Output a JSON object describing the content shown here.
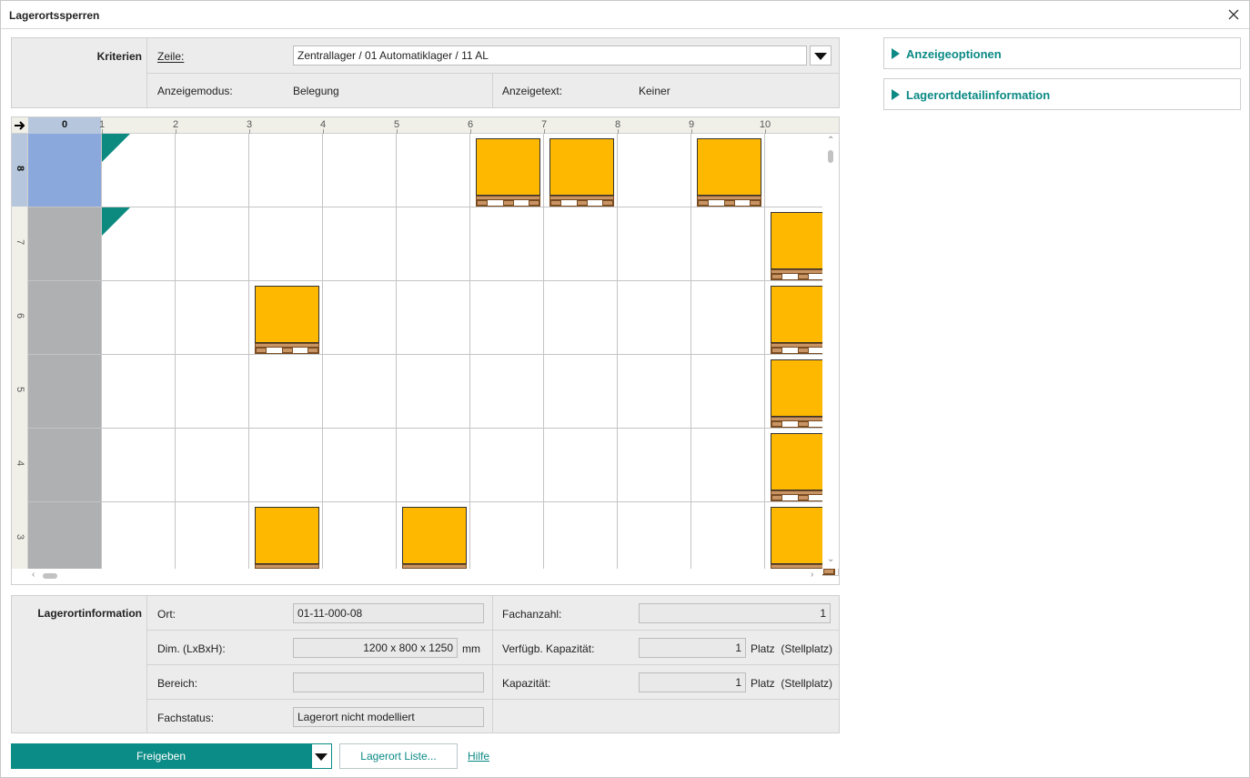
{
  "window": {
    "title": "Lagerortssperren"
  },
  "criteria": {
    "header": "Kriterien",
    "row_label": "Zeile:",
    "row_value": "Zentrallager / 01 Automatiklager / 11 AL",
    "display_mode_label": "Anzeigemodus:",
    "display_mode_value": "Belegung",
    "display_text_label": "Anzeigetext:",
    "display_text_value": "Keiner"
  },
  "grid": {
    "columns": [
      "0",
      "1",
      "2",
      "3",
      "4",
      "5",
      "6",
      "7",
      "8",
      "9",
      "10"
    ],
    "rows": [
      "8",
      "7",
      "6",
      "5",
      "4",
      "3"
    ],
    "selected_column": "0",
    "selected_row": "8",
    "marked_cells": [
      {
        "row": "8",
        "col": "1"
      },
      {
        "row": "7",
        "col": "1"
      }
    ],
    "pallet_cells": [
      {
        "row": "8",
        "col": "6"
      },
      {
        "row": "8",
        "col": "7"
      },
      {
        "row": "8",
        "col": "9"
      },
      {
        "row": "7",
        "col": "10"
      },
      {
        "row": "6",
        "col": "3"
      },
      {
        "row": "6",
        "col": "10"
      },
      {
        "row": "5",
        "col": "10"
      },
      {
        "row": "4",
        "col": "10"
      },
      {
        "row": "3",
        "col": "3"
      },
      {
        "row": "3",
        "col": "5"
      },
      {
        "row": "3",
        "col": "10"
      }
    ],
    "colors": {
      "pallet": "#ffb800",
      "marker": "#0d8a80",
      "selected": "#8aa8dc",
      "column0": "#aeb0b2"
    }
  },
  "info": {
    "header": "Lagerortinformation",
    "ort_label": "Ort:",
    "ort_value": "01-11-000-08",
    "dim_label": "Dim. (LxBxH):",
    "dim_value": "1200 x 800 x 1250",
    "dim_unit": "mm",
    "bereich_label": "Bereich:",
    "bereich_value": "",
    "fachstatus_label": "Fachstatus:",
    "fachstatus_value": "Lagerort nicht modelliert",
    "fachanzahl_label": "Fachanzahl:",
    "fachanzahl_value": "1",
    "verf_label": "Verfügb. Kapazität:",
    "verf_value": "1",
    "verf_unit": "Platz  (Stellplatz)",
    "kap_label": "Kapazität:",
    "kap_value": "1",
    "kap_unit": "Platz  (Stellplatz)"
  },
  "side": {
    "display_options": "Anzeigeoptionen",
    "location_details": "Lagerortdetailinformation"
  },
  "actions": {
    "release": "Freigeben",
    "location_list": "Lagerort Liste...",
    "help": "Hilfe"
  }
}
